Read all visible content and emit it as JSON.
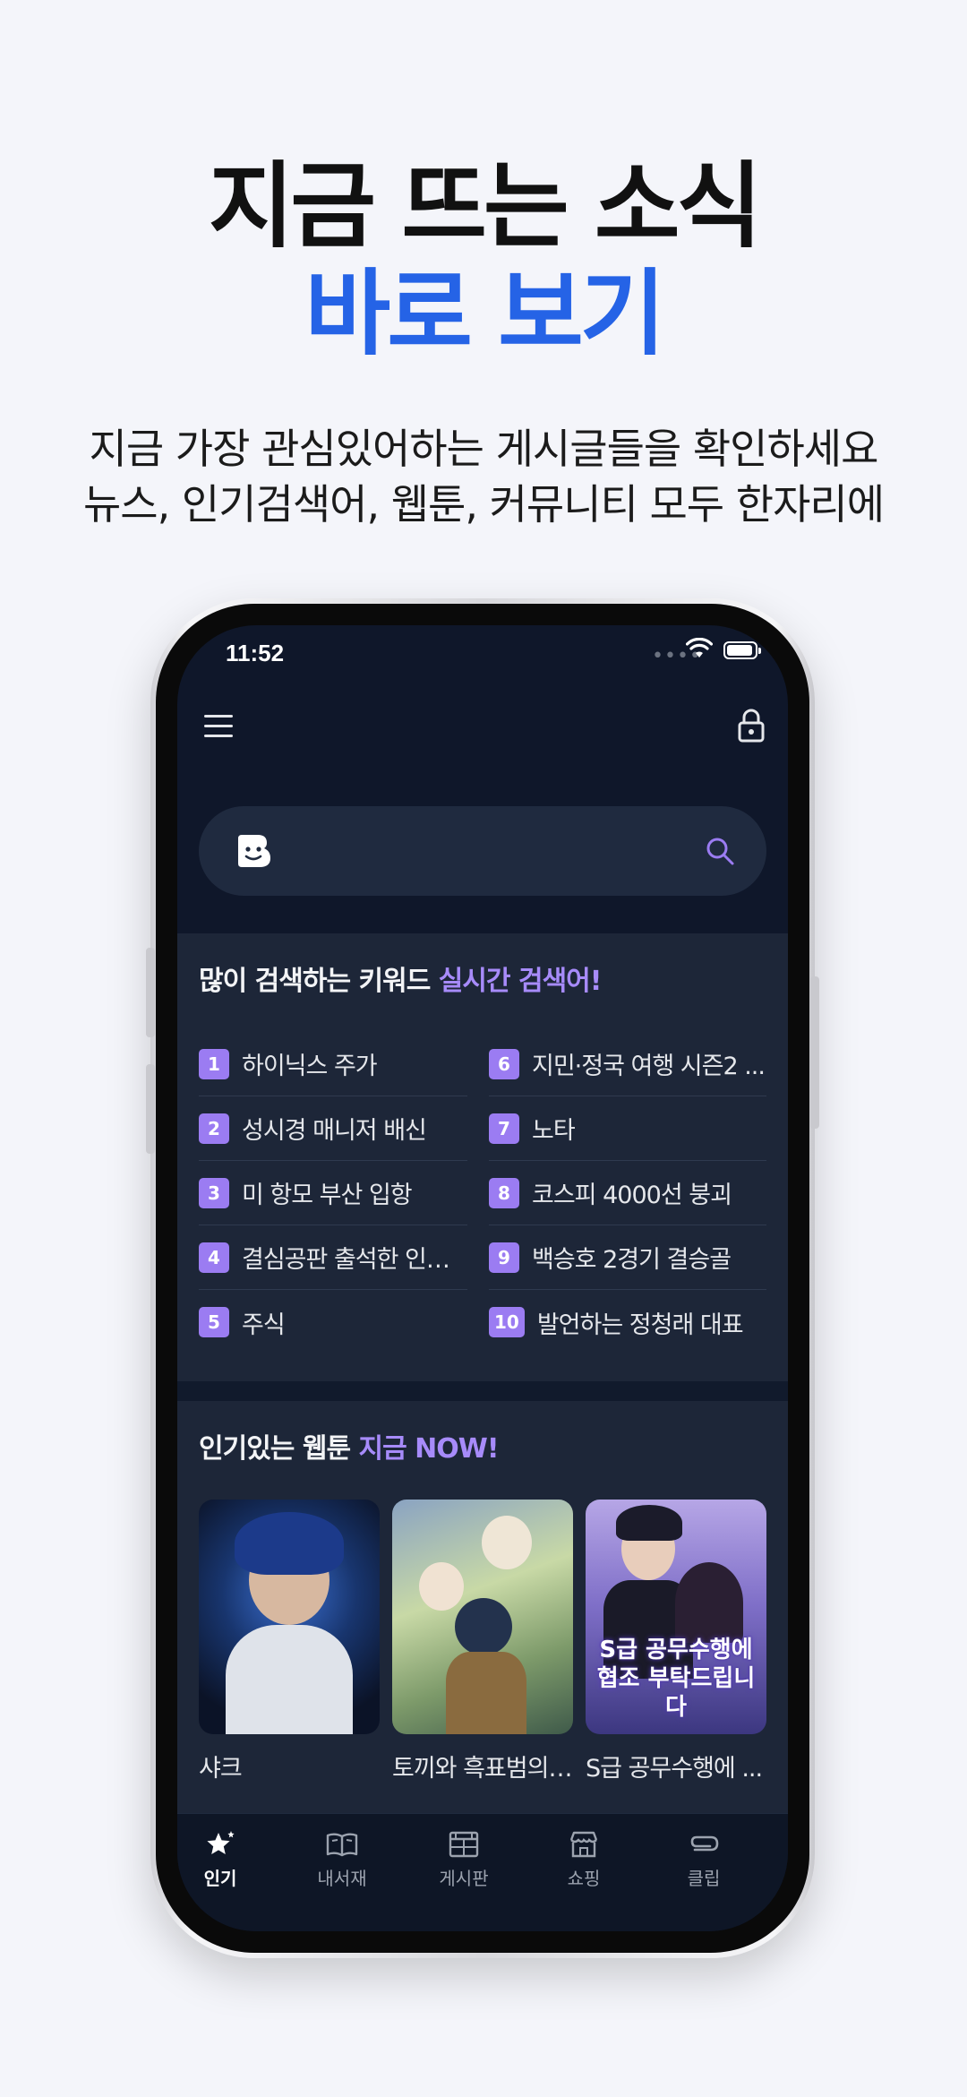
{
  "promo": {
    "title_line1": "지금 뜨는 소식",
    "title_line2": "바로 보기",
    "desc_line1": "지금 가장 관심있어하는 게시글들을 확인하세요",
    "desc_line2": "뉴스, 인기검색어, 웹툰, 커뮤니티 모두 한자리에"
  },
  "status": {
    "time": "11:52",
    "dots": "••••"
  },
  "search": {
    "placeholder": ""
  },
  "keywords": {
    "title_prefix": "많이 검색하는 키워드 ",
    "title_highlight": "실시간 검색어!",
    "items": [
      {
        "rank": "1",
        "text": "하이닉스 주가"
      },
      {
        "rank": "2",
        "text": "성시경 매니저 배신"
      },
      {
        "rank": "3",
        "text": "미 항모 부산 입항"
      },
      {
        "rank": "4",
        "text": "결심공판 출석한 인사들"
      },
      {
        "rank": "5",
        "text": "주식"
      },
      {
        "rank": "6",
        "text": "지민·정국 여행 시즌2 ..."
      },
      {
        "rank": "7",
        "text": "노타"
      },
      {
        "rank": "8",
        "text": "코스피 4000선 붕괴"
      },
      {
        "rank": "9",
        "text": "백승호 2경기 결승골"
      },
      {
        "rank": "10",
        "text": "발언하는 정청래 대표"
      }
    ]
  },
  "webtoons": {
    "title_prefix": "인기있는 웹툰 ",
    "title_highlight": "지금 NOW!",
    "items": [
      {
        "title": "샤크"
      },
      {
        "title": "토끼와 흑표범의 ..."
      },
      {
        "title": "S급 공무수행에 ...",
        "cover_text": "S급 공무수행에 협조 부탁드립니다"
      }
    ]
  },
  "tabs": [
    {
      "label": "인기",
      "icon": "star-icon",
      "active": true
    },
    {
      "label": "내서재",
      "icon": "book-icon",
      "active": false
    },
    {
      "label": "게시판",
      "icon": "board-icon",
      "active": false
    },
    {
      "label": "쇼핑",
      "icon": "shop-icon",
      "active": false
    },
    {
      "label": "클립",
      "icon": "clip-icon",
      "active": false
    }
  ],
  "colors": {
    "accent_blue": "#2563e6",
    "accent_purple": "#a78bfa",
    "rank_badge": "#9b7cf2",
    "screen_bg": "#0f172a"
  }
}
